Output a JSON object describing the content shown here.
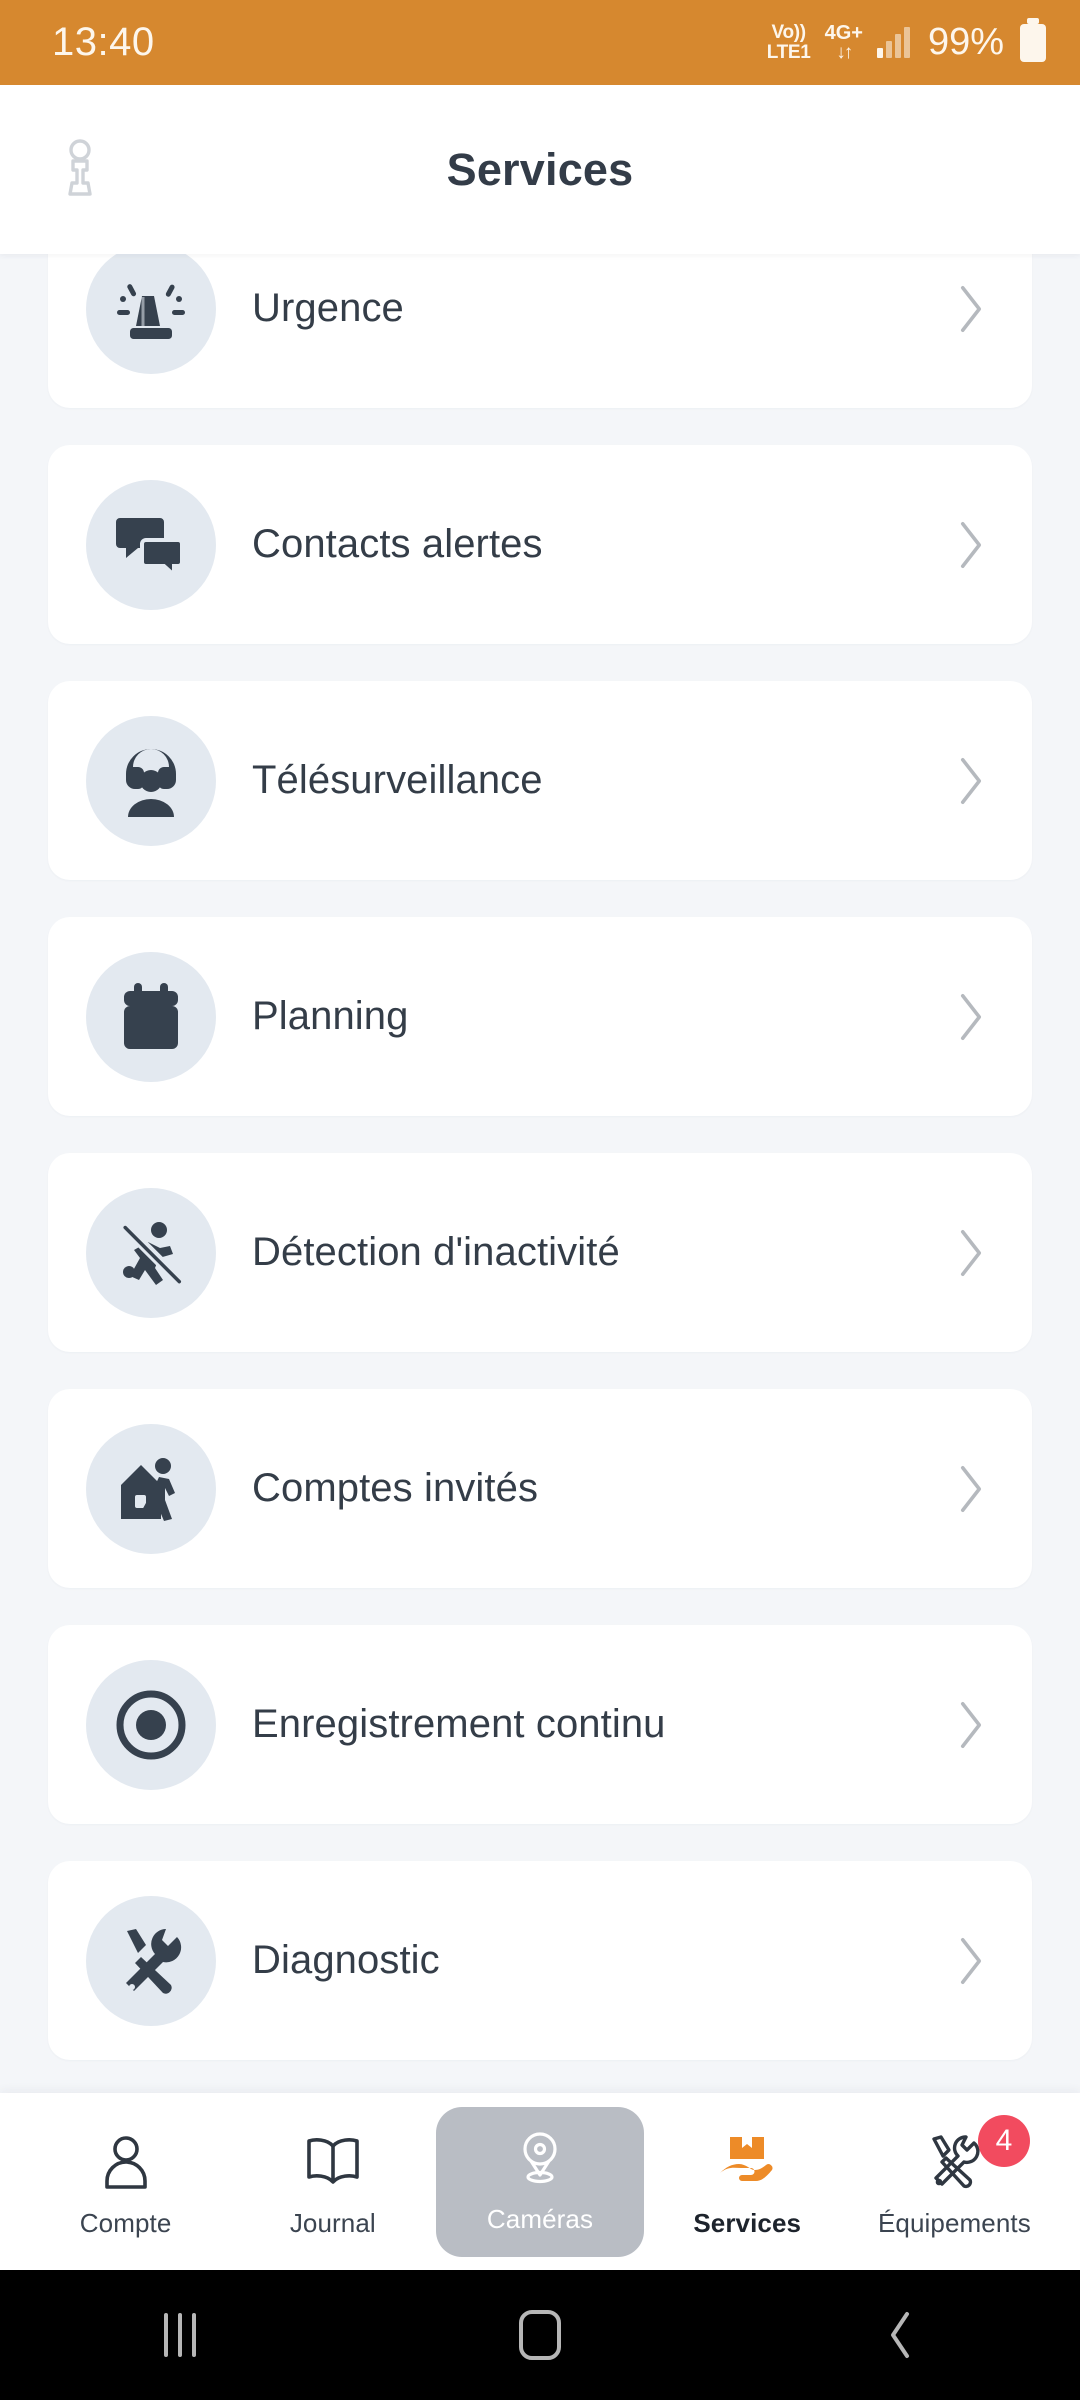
{
  "status_bar": {
    "time": "13:40",
    "volte_top": "Vo))",
    "volte_bottom": "LTE1",
    "network": "4G+",
    "data_arrows": "↓↑",
    "signal_icon": "signal-bars-icon",
    "battery_percent": "99%",
    "battery_icon": "battery-full-icon",
    "background_color": "#d6882f"
  },
  "header": {
    "title": "Services",
    "left_icon": "profile-pawn-icon"
  },
  "services": [
    {
      "label": "Urgence",
      "icon": "siren-icon",
      "chevron": "chevron-right-icon"
    },
    {
      "label": "Contacts alertes",
      "icon": "chat-bubbles-icon",
      "chevron": "chevron-right-icon"
    },
    {
      "label": "Télésurveillance",
      "icon": "headset-agent-icon",
      "chevron": "chevron-right-icon"
    },
    {
      "label": "Planning",
      "icon": "calendar-icon",
      "chevron": "chevron-right-icon"
    },
    {
      "label": "Détection d'inactivité",
      "icon": "no-running-person-icon",
      "chevron": "chevron-right-icon"
    },
    {
      "label": "Comptes invités",
      "icon": "house-person-icon",
      "chevron": "chevron-right-icon"
    },
    {
      "label": "Enregistrement continu",
      "icon": "record-circle-icon",
      "chevron": "chevron-right-icon"
    },
    {
      "label": "Diagnostic",
      "icon": "wrench-screwdriver-icon",
      "chevron": "chevron-right-icon"
    }
  ],
  "tab_bar": {
    "items": [
      {
        "label": "Compte",
        "icon": "person-icon",
        "state": "normal",
        "badge": ""
      },
      {
        "label": "Journal",
        "icon": "open-book-icon",
        "state": "normal",
        "badge": ""
      },
      {
        "label": "Caméras",
        "icon": "dome-camera-icon",
        "state": "selected",
        "badge": ""
      },
      {
        "label": "Services",
        "icon": "box-in-hand-icon",
        "state": "active",
        "badge": ""
      },
      {
        "label": "Équipements",
        "icon": "tools-icon",
        "state": "normal",
        "badge": "4"
      }
    ],
    "active_accent_color": "#ed8b28",
    "selected_pill_color": "#b9bdc4",
    "badge_color": "#f24b5f"
  },
  "android_nav": {
    "recents": "recents-icon",
    "home": "home-icon",
    "back": "back-icon"
  },
  "theme": {
    "page_background": "#f4f6f9",
    "card_background": "#ffffff",
    "icon_circle": "#e3e9f0",
    "text_primary": "#343d48",
    "chevron": "#b5b9be",
    "brand_orange": "#d6882f"
  }
}
